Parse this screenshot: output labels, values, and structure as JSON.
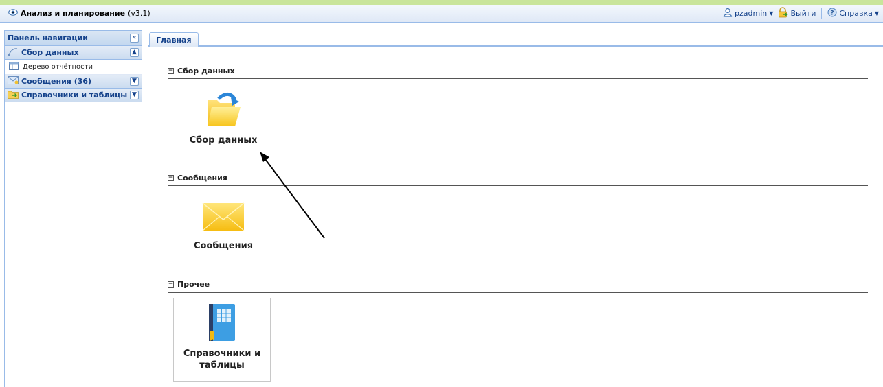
{
  "header": {
    "app_title": "Анализ и планирование",
    "app_version": "(v3.1)",
    "user": "pzadmin",
    "logout": "Выйти",
    "help": "Справка"
  },
  "nav": {
    "title": "Панель навигации",
    "groups": [
      {
        "label": "Сбор данных",
        "items": [
          {
            "label": "Дерево отчётности"
          }
        ]
      },
      {
        "label": "Сообщения (36)"
      },
      {
        "label": "Справочники и таблицы"
      }
    ]
  },
  "tabs": [
    {
      "label": "Главная"
    }
  ],
  "sections": [
    {
      "title": "Сбор данных",
      "tile_label": "Сбор данных"
    },
    {
      "title": "Сообщения",
      "tile_label": "Сообщения"
    },
    {
      "title": "Прочее",
      "tile_label_line1": "Справочники и",
      "tile_label_line2": "таблицы"
    }
  ],
  "colors": {
    "accent_strip": "#c9e59b",
    "panel_border": "#99bbe8",
    "header_text": "#15428b"
  }
}
